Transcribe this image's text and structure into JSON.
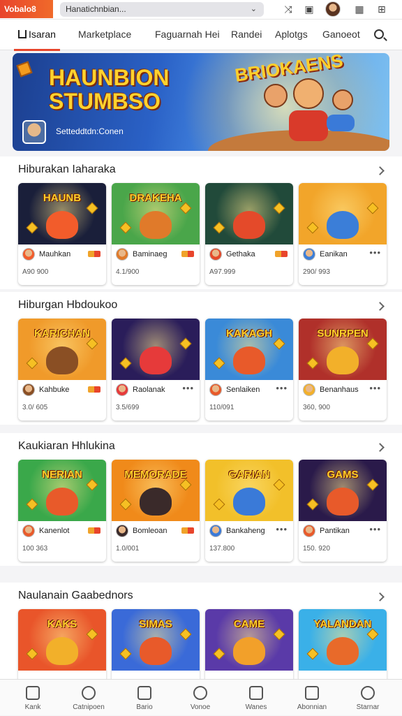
{
  "browser": {
    "brand": "Vobalo8",
    "url": "Hanatichnbian...",
    "icons": [
      "shuffle-icon",
      "image-icon",
      "avatar",
      "calendar-icon",
      "grid-icon"
    ]
  },
  "nav": {
    "tabs": [
      "Isaran",
      "Marketplace",
      "Faguarnah Hei",
      "Randei",
      "Aplotgs",
      "Ganoeot"
    ],
    "active": 0
  },
  "hero": {
    "title_line1": "HAUNBION",
    "title_line2": "STUMBSO",
    "tag": "BRIOKAENS",
    "subtitle": "Setteddtdn:Conen"
  },
  "sections": [
    {
      "title": "Hiburakan Iaharaka",
      "cards": [
        {
          "label": "HAUNB",
          "name": "Mauhkan",
          "stat": "A90 900",
          "bg": "#1a1f3a",
          "accent": "#f25c2b",
          "meta": "badge"
        },
        {
          "label": "DRAKEHA",
          "name": "Baminaeg",
          "stat": "4.1/900",
          "bg": "#4aa64a",
          "accent": "#e07a2a",
          "meta": "badge"
        },
        {
          "label": "",
          "name": "Gethaka",
          "stat": "A97.999",
          "bg": "#214a3a",
          "accent": "#e44a2a",
          "meta": "badge"
        },
        {
          "label": "",
          "name": "Eanikan",
          "stat": "290/ 993",
          "bg": "#f2a52a",
          "accent": "#3b7ed8",
          "meta": "dots"
        }
      ]
    },
    {
      "title": "Hiburgan Hbdoukoo",
      "cards": [
        {
          "label": "KARICHAN",
          "name": "Kahbuke",
          "stat": "3.0/ 605",
          "bg": "#f09a2a",
          "accent": "#8a4f24",
          "meta": "badge"
        },
        {
          "label": "",
          "name": "Raolanak",
          "stat": "3.5/699",
          "bg": "#2a1d5a",
          "accent": "#e63a3a",
          "meta": "dots"
        },
        {
          "label": "KAKAGH",
          "name": "Senlaiken",
          "stat": "110/091",
          "bg": "#3a8ad8",
          "accent": "#e85a2a",
          "meta": "dots"
        },
        {
          "label": "SUNRPEN",
          "name": "Benanhaus",
          "stat": "360, 900",
          "bg": "#b0302a",
          "accent": "#f2b02a",
          "meta": "dots"
        }
      ]
    },
    {
      "title": "Kaukiaran Hhlukina",
      "cards": [
        {
          "label": "NERIAN",
          "name": "Kanenlot",
          "stat": "100 363",
          "bg": "#3aa84a",
          "accent": "#e85a2a",
          "meta": "badge"
        },
        {
          "label": "MEMORADE",
          "name": "Bomleoan",
          "stat": "1.0/001",
          "bg": "#f08a1a",
          "accent": "#3a2a2a",
          "meta": "badge"
        },
        {
          "label": "GARIAN",
          "name": "Bankaheng",
          "stat": "137.800",
          "bg": "#f2c02a",
          "accent": "#3a7ad8",
          "meta": "dots"
        },
        {
          "label": "GAMS",
          "name": "Pantikan",
          "stat": "150. 920",
          "bg": "#2a1a4a",
          "accent": "#e85a2a",
          "meta": "dots"
        }
      ]
    },
    {
      "title": "Naulanain Gaabednors",
      "cards": [
        {
          "label": "KAKS",
          "name": "",
          "stat": "",
          "bg": "#e9552a",
          "accent": "#f2b02a",
          "meta": ""
        },
        {
          "label": "SIMAS",
          "name": "",
          "stat": "",
          "bg": "#3a6ad8",
          "accent": "#e85a2a",
          "meta": ""
        },
        {
          "label": "CAME",
          "name": "",
          "stat": "",
          "bg": "#5a3aa8",
          "accent": "#f2a02a",
          "meta": ""
        },
        {
          "label": "YALANDAN",
          "name": "",
          "stat": "",
          "bg": "#3ab0e8",
          "accent": "#e86a2a",
          "meta": ""
        }
      ]
    }
  ],
  "bottom_nav": [
    "Kank",
    "Catnipoen",
    "Bario",
    "Vonoe",
    "Wanes",
    "Abonnian",
    "Starnar"
  ],
  "colors": {
    "accent": "#e8452c",
    "brand_gold": "#ffd22e"
  }
}
